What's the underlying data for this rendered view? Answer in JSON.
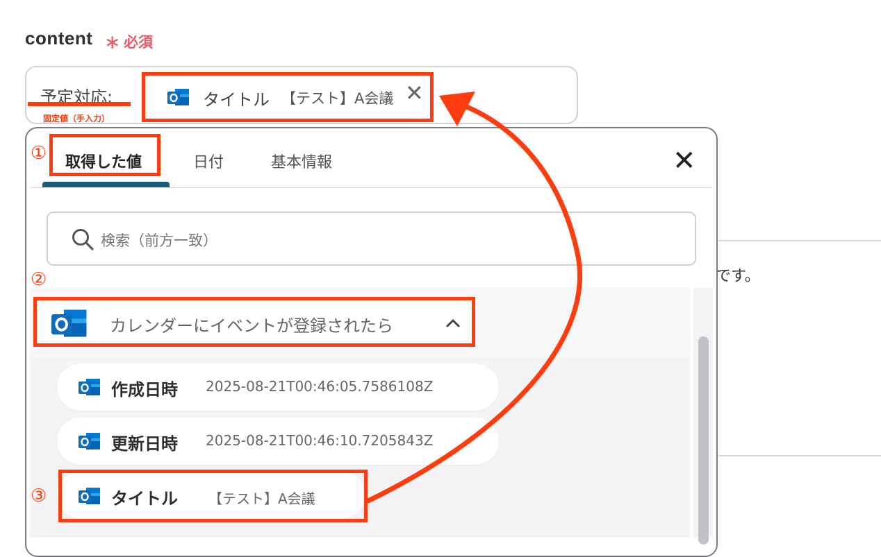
{
  "field": {
    "label": "content",
    "required_star": "∗",
    "required_text": "必須"
  },
  "input": {
    "fixed_text": "予定対応:",
    "fixed_caption": "固定値（手入力）",
    "chip_label": "タイトル",
    "chip_value": "【テスト】A会議",
    "chip_close": "✕"
  },
  "background": {
    "partial_text": "です。"
  },
  "popover": {
    "tabs": [
      {
        "label": "取得した値"
      },
      {
        "label": "日付"
      },
      {
        "label": "基本情報"
      }
    ],
    "close": "✕",
    "search_placeholder": "検索（前方一致）",
    "group": {
      "label": "カレンダーにイベントが登録されたら"
    },
    "items": [
      {
        "label": "作成日時",
        "value": "2025-08-21T00:46:05.7586108Z"
      },
      {
        "label": "更新日時",
        "value": "2025-08-21T00:46:10.7205843Z"
      },
      {
        "label": "タイトル",
        "value": "【テスト】A会議"
      }
    ]
  },
  "annotations": {
    "step1": "①",
    "step2": "②",
    "step3": "③"
  },
  "colors": {
    "highlight": "#fd3d0d",
    "required": "#ea5b64",
    "tab_active": "#1a5a7a",
    "outlook_blue": "#0f6cbd"
  },
  "icons": {
    "app": "outlook-icon",
    "search": "search-icon",
    "close": "close-icon",
    "chevron": "chevron-up-icon"
  }
}
